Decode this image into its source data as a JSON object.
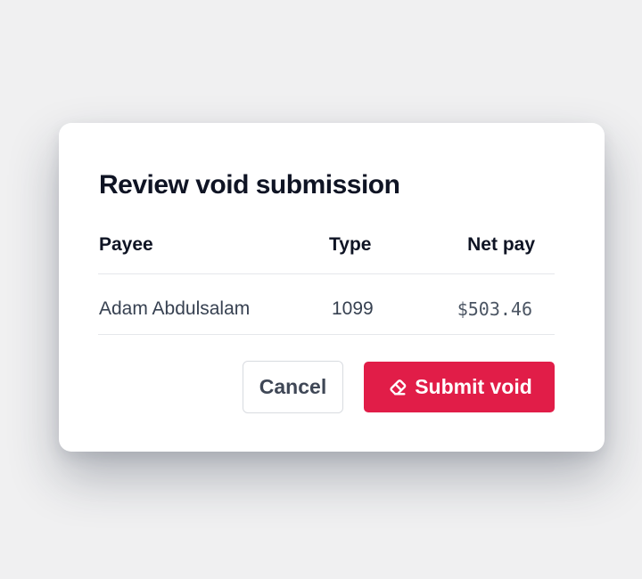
{
  "modal": {
    "title": "Review void submission"
  },
  "table": {
    "headers": {
      "payee": "Payee",
      "type": "Type",
      "net_pay": "Net pay"
    },
    "rows": [
      {
        "payee": "Adam Abdulsalam",
        "type": "1099",
        "net_pay": "$503.46"
      }
    ]
  },
  "actions": {
    "cancel_label": "Cancel",
    "submit_label": "Submit void",
    "submit_icon": "eraser-icon",
    "submit_color": "#e11d48"
  }
}
